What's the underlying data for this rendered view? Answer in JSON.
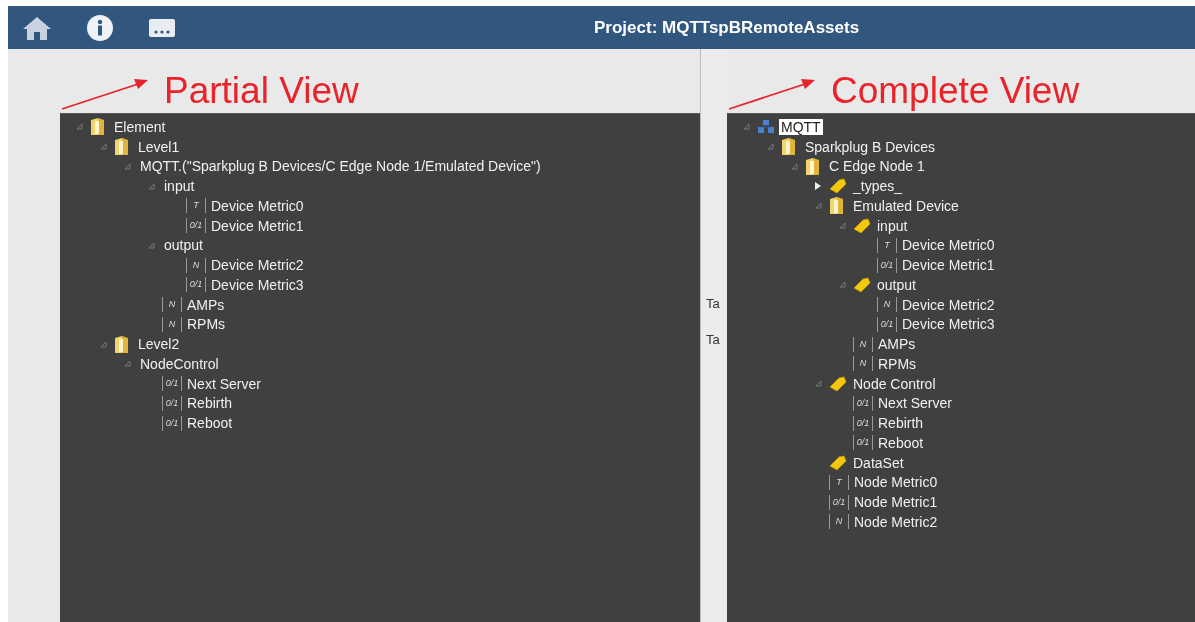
{
  "header": {
    "title": "Project: MQTTspBRemoteAssets"
  },
  "annotations": [
    {
      "label": "Partial View"
    },
    {
      "label": "Complete View"
    }
  ],
  "side_labels": [
    "Ta",
    "Ta"
  ],
  "trees": [
    {
      "nodes": [
        {
          "kind": "folder",
          "label": "Element",
          "expanded": true,
          "selected": false,
          "children": [
            {
              "kind": "folder",
              "label": "Level1",
              "expanded": true,
              "selected": false,
              "children": [
                {
                  "kind": "plain",
                  "label": "MQTT.(\"Sparkplug B Devices/C Edge Node 1/Emulated Device\")",
                  "expanded": true,
                  "selected": false,
                  "children": [
                    {
                      "kind": "plain",
                      "label": "input",
                      "expanded": true,
                      "selected": false,
                      "children": [
                        {
                          "kind": "metric",
                          "badge": "T",
                          "label": "Device Metric0",
                          "selected": false
                        },
                        {
                          "kind": "metric",
                          "badge": "0/1",
                          "label": "Device Metric1",
                          "selected": false
                        }
                      ]
                    },
                    {
                      "kind": "plain",
                      "label": "output",
                      "expanded": true,
                      "selected": false,
                      "children": [
                        {
                          "kind": "metric",
                          "badge": "N",
                          "label": "Device Metric2",
                          "selected": false
                        },
                        {
                          "kind": "metric",
                          "badge": "0/1",
                          "label": "Device Metric3",
                          "selected": false
                        }
                      ]
                    },
                    {
                      "kind": "metric",
                      "badge": "N",
                      "label": "AMPs",
                      "selected": false
                    },
                    {
                      "kind": "metric",
                      "badge": "N",
                      "label": "RPMs",
                      "selected": false
                    }
                  ]
                }
              ]
            },
            {
              "kind": "folder",
              "label": "Level2",
              "expanded": true,
              "selected": false,
              "children": [
                {
                  "kind": "plain",
                  "label": "NodeControl",
                  "expanded": true,
                  "selected": false,
                  "children": [
                    {
                      "kind": "metric",
                      "badge": "0/1",
                      "label": "Next Server",
                      "selected": false
                    },
                    {
                      "kind": "metric",
                      "badge": "0/1",
                      "label": "Rebirth",
                      "selected": false
                    },
                    {
                      "kind": "metric",
                      "badge": "0/1",
                      "label": "Reboot",
                      "selected": false
                    }
                  ]
                }
              ]
            }
          ]
        }
      ]
    },
    {
      "nodes": [
        {
          "kind": "server",
          "label": "MQTT",
          "expanded": true,
          "selected": true,
          "children": [
            {
              "kind": "folder",
              "label": "Sparkplug B Devices",
              "expanded": true,
              "selected": false,
              "children": [
                {
                  "kind": "folder",
                  "label": "C Edge Node 1",
                  "expanded": true,
                  "selected": false,
                  "children": [
                    {
                      "kind": "tag",
                      "label": "_types_",
                      "expanded": false,
                      "selected": false
                    },
                    {
                      "kind": "folder",
                      "label": "Emulated Device",
                      "expanded": true,
                      "selected": false,
                      "children": [
                        {
                          "kind": "tag",
                          "label": "input",
                          "expanded": true,
                          "selected": false,
                          "children": [
                            {
                              "kind": "metric",
                              "badge": "T",
                              "label": "Device Metric0",
                              "selected": false
                            },
                            {
                              "kind": "metric",
                              "badge": "0/1",
                              "label": "Device Metric1",
                              "selected": false
                            }
                          ]
                        },
                        {
                          "kind": "tag",
                          "label": "output",
                          "expanded": true,
                          "selected": false,
                          "children": [
                            {
                              "kind": "metric",
                              "badge": "N",
                              "label": "Device Metric2",
                              "selected": false
                            },
                            {
                              "kind": "metric",
                              "badge": "0/1",
                              "label": "Device Metric3",
                              "selected": false
                            }
                          ]
                        },
                        {
                          "kind": "metric",
                          "badge": "N",
                          "label": "AMPs",
                          "selected": false
                        },
                        {
                          "kind": "metric",
                          "badge": "N",
                          "label": "RPMs",
                          "selected": false
                        }
                      ]
                    },
                    {
                      "kind": "tag",
                      "label": "Node Control",
                      "expanded": true,
                      "selected": false,
                      "children": [
                        {
                          "kind": "metric",
                          "badge": "0/1",
                          "label": "Next Server",
                          "selected": false
                        },
                        {
                          "kind": "metric",
                          "badge": "0/1",
                          "label": "Rebirth",
                          "selected": false
                        },
                        {
                          "kind": "metric",
                          "badge": "0/1",
                          "label": "Reboot",
                          "selected": false
                        }
                      ]
                    },
                    {
                      "kind": "tag",
                      "label": "DataSet",
                      "selected": false
                    },
                    {
                      "kind": "metric",
                      "badge": "T",
                      "label": "Node Metric0",
                      "selected": false
                    },
                    {
                      "kind": "metric",
                      "badge": "0/1",
                      "label": "Node Metric1",
                      "selected": false
                    },
                    {
                      "kind": "metric",
                      "badge": "N",
                      "label": "Node Metric2",
                      "selected": false
                    }
                  ]
                }
              ]
            }
          ]
        }
      ]
    }
  ]
}
